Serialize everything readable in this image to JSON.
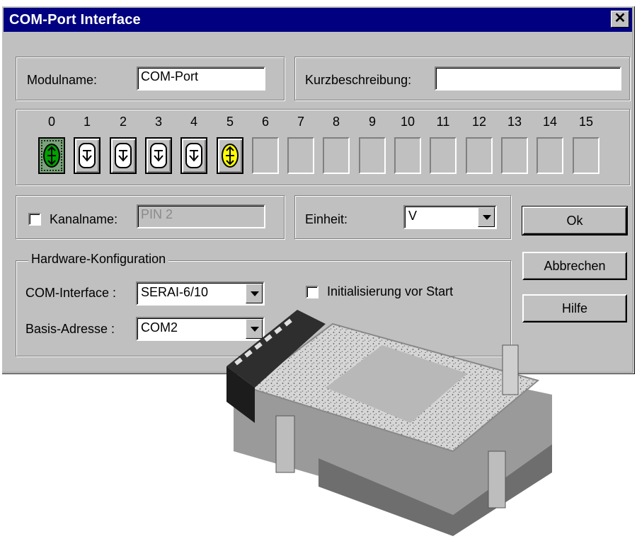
{
  "window": {
    "title": "COM-Port Interface",
    "close_label": "✕"
  },
  "module": {
    "name_label": "Modulname:",
    "name_value": "COM-Port",
    "desc_label": "Kurzbeschreibung:",
    "desc_value": ""
  },
  "channels": {
    "numbers": [
      "0",
      "1",
      "2",
      "3",
      "4",
      "5",
      "6",
      "7",
      "8",
      "9",
      "10",
      "11",
      "12",
      "13",
      "14",
      "15"
    ],
    "states": [
      "active-green",
      "output",
      "output",
      "output",
      "output",
      "active-yellow",
      "empty",
      "empty",
      "empty",
      "empty",
      "empty",
      "empty",
      "empty",
      "empty",
      "empty",
      "empty"
    ]
  },
  "channel_name": {
    "checkbox_label": "Kanalname:",
    "value": "PIN 2",
    "checked": false
  },
  "unit": {
    "label": "Einheit:",
    "value": "V"
  },
  "hardware": {
    "legend": "Hardware-Konfiguration",
    "interface_label": "COM-Interface :",
    "interface_value": "SERAI-6/10",
    "address_label": "Basis-Adresse :",
    "address_value": "COM2",
    "init_label": "Initialisierung vor Start",
    "init_checked": false
  },
  "buttons": {
    "ok": "Ok",
    "cancel": "Abbrechen",
    "help": "Hilfe"
  },
  "colors": {
    "title_bar": "#000080",
    "dialog_bg": "#c0c0c0",
    "channel_active_green": "#00a000",
    "channel_active_yellow": "#ffff00"
  }
}
